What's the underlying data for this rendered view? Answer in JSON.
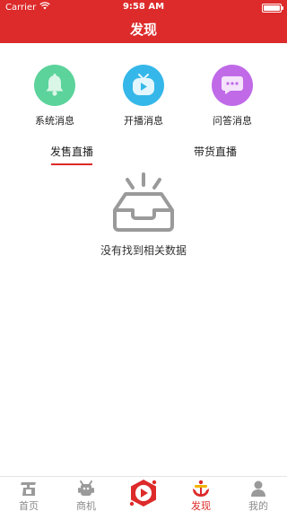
{
  "status_bar": {
    "carrier": "Carrier",
    "time": "9:58 AM",
    "battery_level": 1.0
  },
  "nav": {
    "title": "发现"
  },
  "entries": [
    {
      "label": "系统消息",
      "icon": "bell-icon",
      "color": "#5cd39b"
    },
    {
      "label": "开播消息",
      "icon": "tv-play-icon",
      "color": "#35b7e9"
    },
    {
      "label": "问答消息",
      "icon": "chat-bubble-icon",
      "color": "#c06ae8"
    }
  ],
  "tabs": [
    {
      "label": "发售直播",
      "active": true
    },
    {
      "label": "带货直播",
      "active": false
    }
  ],
  "empty_state": {
    "icon": "empty-box-icon",
    "text": "没有找到相关数据"
  },
  "tabbar": {
    "items": [
      {
        "label": "首页",
        "icon": "home-shop-icon",
        "active": false
      },
      {
        "label": "商机",
        "icon": "robot-icon",
        "active": false
      },
      {
        "label": "",
        "icon": "play-center-icon",
        "active": false
      },
      {
        "label": "发现",
        "icon": "discover-anchor-icon",
        "active": true
      },
      {
        "label": "我的",
        "icon": "user-icon",
        "active": false
      }
    ]
  },
  "colors": {
    "accent": "#dd2a2a",
    "inactive": "#8a8a8a"
  }
}
